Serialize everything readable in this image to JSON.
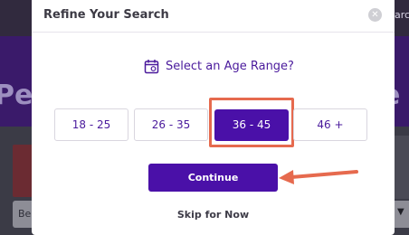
{
  "background": {
    "search_partial": "arc",
    "hero_left_partial": "Pe",
    "hero_right_partial": "e",
    "select_left_partial": "Be",
    "select_right_caret": "▼"
  },
  "modal": {
    "title": "Refine Your Search",
    "close_icon": "close-icon",
    "question_icon": "calendar-icon",
    "question": "Select an Age Range?",
    "age_options": [
      "18 - 25",
      "26 - 35",
      "36 - 45",
      "46 +"
    ],
    "selected_option": "36 - 45",
    "continue_label": "Continue",
    "skip_label": "Skip for Now"
  },
  "colors": {
    "accent": "#4a10a8",
    "highlight": "#e66a4e",
    "text_purple": "#4a1a9c"
  }
}
